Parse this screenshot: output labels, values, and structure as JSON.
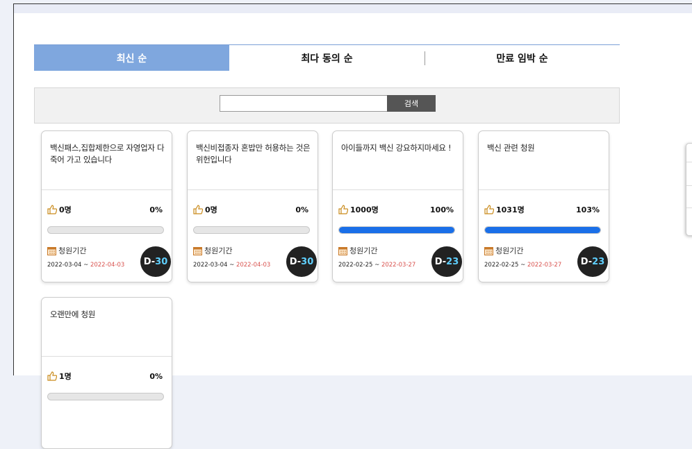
{
  "tabs": [
    {
      "label": "최신 순",
      "active": true
    },
    {
      "label": "최다 동의 순",
      "active": false
    },
    {
      "label": "만료 임박 순",
      "active": false
    }
  ],
  "search": {
    "placeholder": "",
    "value": "",
    "button_label": "검색"
  },
  "cards": [
    {
      "title": "백신패스,집합제한으로 자영업자 다죽어 가고 있습니다",
      "count": "0명",
      "percent": "0%",
      "progress": 0,
      "period_label": "청원기간",
      "start": "2022-03-04",
      "separator": " ~ ",
      "end": "2022-04-03",
      "dday_prefix": "D-",
      "dday_num": "30"
    },
    {
      "title": "백신비접종자 혼밥만 허용하는 것은 위헌입니다",
      "count": "0명",
      "percent": "0%",
      "progress": 0,
      "period_label": "청원기간",
      "start": "2022-03-04",
      "separator": " ~ ",
      "end": "2022-04-03",
      "dday_prefix": "D-",
      "dday_num": "30"
    },
    {
      "title": "아이들까지 백신 강요하지마세요 !",
      "count": "1000명",
      "percent": "100%",
      "progress": 1.0,
      "period_label": "청원기간",
      "start": "2022-02-25",
      "separator": " ~ ",
      "end": "2022-03-27",
      "dday_prefix": "D-",
      "dday_num": "23"
    },
    {
      "title": "백신 관련 청원",
      "count": "1031명",
      "percent": "103%",
      "progress": 1.0,
      "period_label": "청원기간",
      "start": "2022-02-25",
      "separator": " ~ ",
      "end": "2022-03-27",
      "dday_prefix": "D-",
      "dday_num": "23"
    },
    {
      "title": "오랜만에 청원",
      "count": "1명",
      "percent": "0%",
      "progress": 0,
      "period_label": "청원기간",
      "start": "",
      "separator": "",
      "end": "",
      "dday_prefix": "",
      "dday_num": ""
    }
  ],
  "colors": {
    "tab_active": "#7fa7de",
    "progress_fill": "#1a6fe8",
    "end_date": "#d9534f",
    "dday_number": "#5fd0ff"
  }
}
